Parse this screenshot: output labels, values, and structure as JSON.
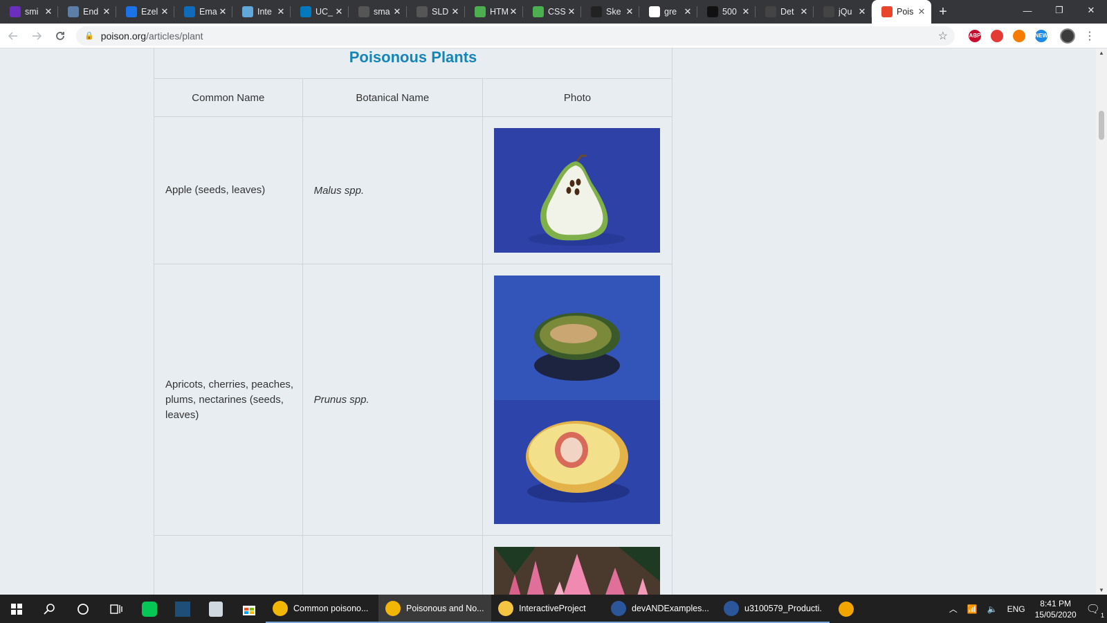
{
  "browser": {
    "tabs": [
      {
        "title": "smi",
        "icon": "mail-icon",
        "color": "#6b2fbf"
      },
      {
        "title": "End",
        "icon": "globe-icon",
        "color": "#5b7fa8"
      },
      {
        "title": "Ezel",
        "icon": "bookmark-icon",
        "color": "#1a73e8"
      },
      {
        "title": "Ema",
        "icon": "outlook-icon",
        "color": "#0f6cbd"
      },
      {
        "title": "Inte",
        "icon": "react-icon",
        "color": "#61a8d8"
      },
      {
        "title": "UC_",
        "icon": "trello-icon",
        "color": "#0079bf"
      },
      {
        "title": "sma",
        "icon": "github-icon",
        "color": "#555555"
      },
      {
        "title": "SLD",
        "icon": "github-icon",
        "color": "#555555"
      },
      {
        "title": "HTM",
        "icon": "w3-icon",
        "color": "#4caf50"
      },
      {
        "title": "CSS",
        "icon": "w3-icon",
        "color": "#4caf50"
      },
      {
        "title": "Ske",
        "icon": "s-logo-icon",
        "color": "#222222"
      },
      {
        "title": "gre",
        "icon": "google-icon",
        "color": "#ffffff"
      },
      {
        "title": "500",
        "icon": "server-icon",
        "color": "#111111"
      },
      {
        "title": "Det",
        "icon": "circle-icon",
        "color": "#444444"
      },
      {
        "title": "jQu",
        "icon": "circle-icon",
        "color": "#444444"
      },
      {
        "title": "Pois",
        "icon": "pill-icon",
        "color": "#e8452c"
      }
    ],
    "new_tab": "+",
    "window_controls": {
      "minimize": "—",
      "restore": "❐",
      "close": "✕"
    },
    "url_domain": "poison.org",
    "url_path": "/articles/plant",
    "extensions": [
      {
        "label": "ABP",
        "color": "#c70d2c"
      },
      {
        "label": "",
        "color": "#e53935"
      },
      {
        "label": "",
        "color": "#f57c00"
      },
      {
        "label": "NEW",
        "color": "#1e88e5"
      }
    ]
  },
  "page": {
    "heading": "Poisonous Plants",
    "columns": [
      "Common Name",
      "Botanical Name",
      "Photo"
    ],
    "rows": [
      {
        "common": "Apple (seeds, leaves)",
        "botanical": "Malus spp.",
        "photo": "apple-photo"
      },
      {
        "common": "Apricots, cherries, peaches, plums, nectarines (seeds, leaves)",
        "botanical": "Prunus spp.",
        "photo": "stone-fruit-photo"
      },
      {
        "common": "",
        "botanical": "",
        "photo": "pink-flower-photo"
      }
    ]
  },
  "taskbar": {
    "apps": [
      {
        "label": "Common poisono...",
        "color": "#f2b705",
        "active": false
      },
      {
        "label": "Poisonous and No...",
        "color": "#f2b705",
        "active": true
      },
      {
        "label": "InteractiveProject",
        "color": "#f5c542",
        "active": false
      },
      {
        "label": "devANDExamples....",
        "color": "#2b579a",
        "active": false
      },
      {
        "label": "u3100579_Producti...",
        "color": "#2b579a",
        "active": false
      }
    ],
    "language": "ENG",
    "time": "8:41 PM",
    "date": "15/05/2020",
    "notification_count": "1"
  }
}
